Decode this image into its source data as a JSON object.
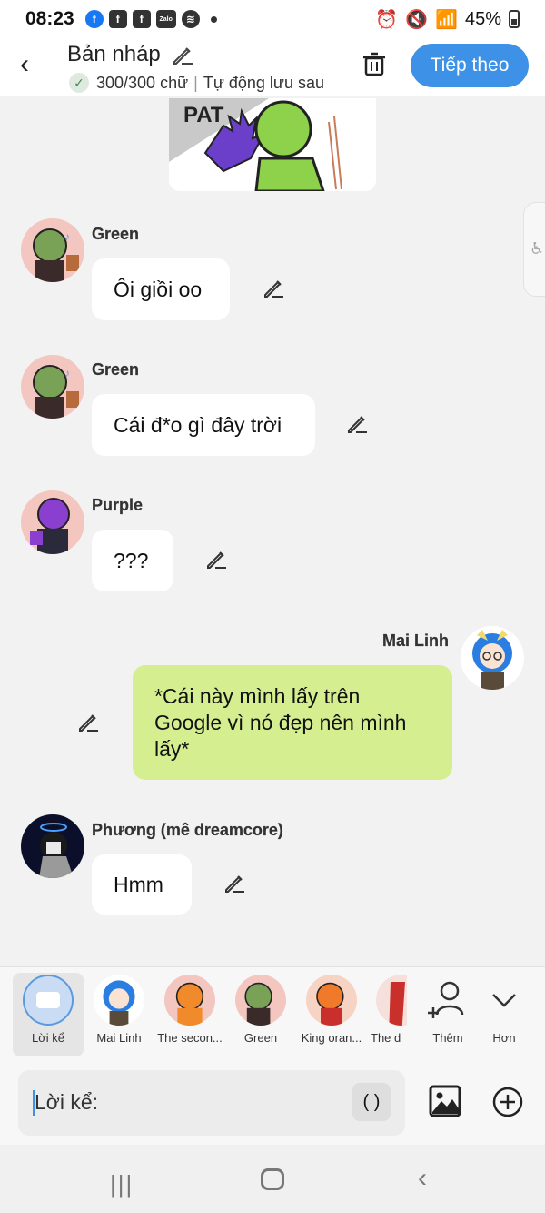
{
  "status_bar": {
    "time": "08:23",
    "app_icons": [
      "facebook-icon",
      "facebook-icon",
      "facebook-icon",
      "zalo-icon",
      "spotify-icon"
    ],
    "zalo_label": "Zalo",
    "battery": "45%"
  },
  "header": {
    "title": "Bản nháp",
    "word_count": "300/300 chữ",
    "autosave": "Tự động lưu sau",
    "next_label": "Tiếp theo",
    "accent": "#3d91e6"
  },
  "messages": [
    {
      "sender": "Green",
      "text": "Ôi giồi oo"
    },
    {
      "sender": "Green",
      "text": "Cái đ*o gì đây trời"
    },
    {
      "sender": "Purple",
      "text": "???"
    },
    {
      "sender": "Mai Linh",
      "text": "*Cái này mình lấy trên Google vì nó đẹp nên mình lấy*",
      "mine": true
    },
    {
      "sender": "Phương (mê dreamcore)",
      "text": "Hmm"
    }
  ],
  "image_caption": "PAT",
  "characters": [
    {
      "label": "Lời kể"
    },
    {
      "label": "Mai Linh"
    },
    {
      "label": "The secon..."
    },
    {
      "label": "Green"
    },
    {
      "label": "King oran..."
    },
    {
      "label": "The d"
    }
  ],
  "actions": {
    "more_label": "Thêm",
    "less_label": "Hơn"
  },
  "input": {
    "placeholder": "Lời kể:",
    "paren": "( )"
  },
  "colors": {
    "mine_bubble": "#d5ee8f",
    "background": "#f2f2f3"
  }
}
